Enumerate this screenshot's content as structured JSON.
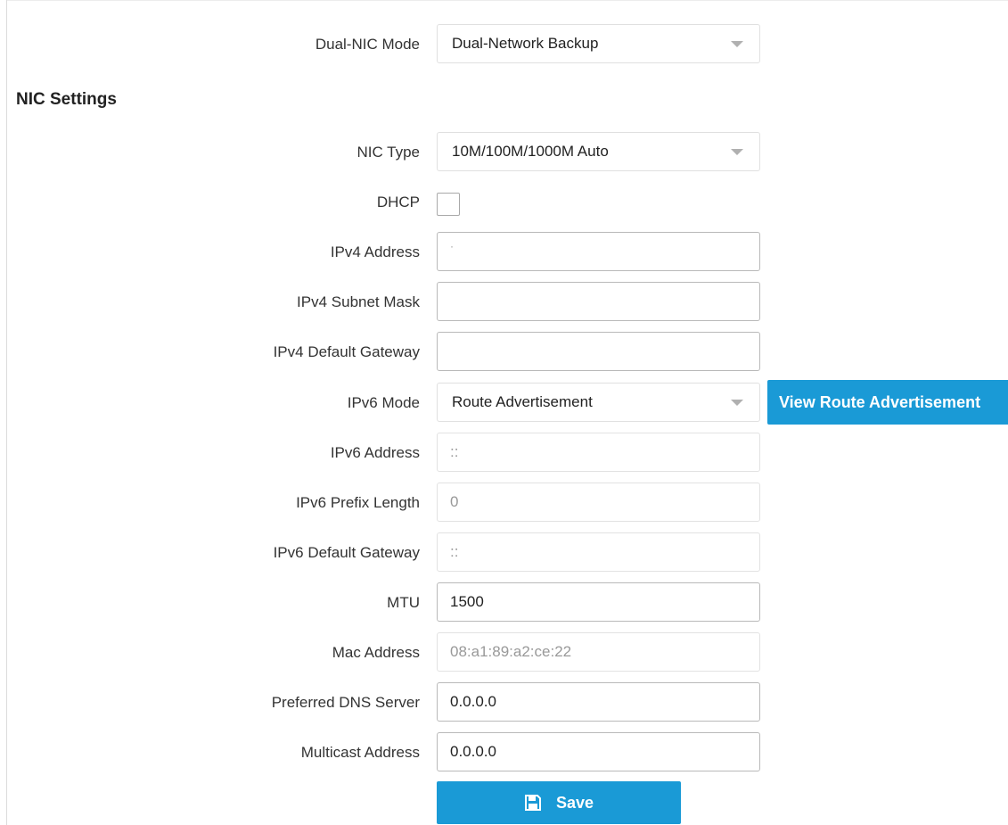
{
  "dual_nic": {
    "label": "Dual-NIC Mode",
    "value": "Dual-Network Backup"
  },
  "section_title": "NIC Settings",
  "fields": {
    "nic_type": {
      "label": "NIC Type",
      "value": "10M/100M/1000M Auto"
    },
    "dhcp": {
      "label": "DHCP",
      "checked": false
    },
    "ipv4_address": {
      "label": "IPv4 Address",
      "value": "·"
    },
    "ipv4_subnet": {
      "label": "IPv4 Subnet Mask",
      "value": ""
    },
    "ipv4_gateway": {
      "label": "IPv4 Default Gateway",
      "value": ""
    },
    "ipv6_mode": {
      "label": "IPv6 Mode",
      "value": "Route Advertisement"
    },
    "ipv6_address": {
      "label": "IPv6 Address",
      "value": "::"
    },
    "ipv6_prefix": {
      "label": "IPv6 Prefix Length",
      "value": "0"
    },
    "ipv6_gateway": {
      "label": "IPv6 Default Gateway",
      "value": "::"
    },
    "mtu": {
      "label": "MTU",
      "value": "1500"
    },
    "mac_address": {
      "label": "Mac Address",
      "value": "08:a1:89:a2:ce:22"
    },
    "preferred_dns": {
      "label": "Preferred DNS Server",
      "value": "0.0.0.0"
    },
    "multicast": {
      "label": "Multicast Address",
      "value": "0.0.0.0"
    }
  },
  "buttons": {
    "view_route": "View Route Advertisement",
    "save": "Save"
  },
  "icons": {
    "save": "floppy-disk-icon",
    "dropdown": "caret-down-icon"
  },
  "colors": {
    "accent": "#1a9ad6"
  }
}
